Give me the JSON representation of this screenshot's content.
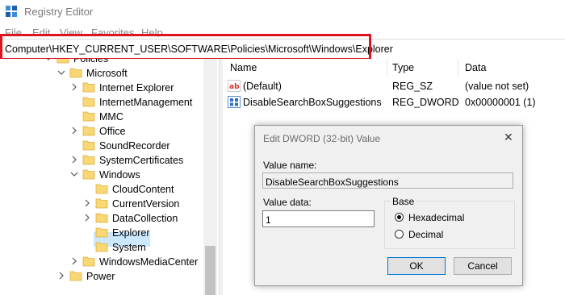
{
  "window": {
    "title": "Registry Editor"
  },
  "menu": [
    "File",
    "Edit",
    "View",
    "Favorites",
    "Help"
  ],
  "address": {
    "path": "Computer\\HKEY_CURRENT_USER\\SOFTWARE\\Policies\\Microsoft\\Windows\\Explorer"
  },
  "tree": {
    "items": [
      {
        "label": "Policies",
        "expanded": true,
        "selected": false
      },
      {
        "label": "Microsoft",
        "expanded": true,
        "selected": false
      },
      {
        "label": "Internet Explorer",
        "expanded": false,
        "selected": false
      },
      {
        "label": "InternetManagement",
        "expanded": false,
        "selected": false
      },
      {
        "label": "MMC",
        "expanded": false,
        "selected": false
      },
      {
        "label": "Office",
        "expanded": false,
        "selected": false
      },
      {
        "label": "SoundRecorder",
        "expanded": false,
        "selected": false
      },
      {
        "label": "SystemCertificates",
        "expanded": false,
        "selected": false
      },
      {
        "label": "Windows",
        "expanded": true,
        "selected": false
      },
      {
        "label": "CloudContent",
        "expanded": false,
        "selected": false
      },
      {
        "label": "CurrentVersion",
        "expanded": false,
        "selected": false
      },
      {
        "label": "DataCollection",
        "expanded": false,
        "selected": false
      },
      {
        "label": "Explorer",
        "expanded": false,
        "selected": true
      },
      {
        "label": "System",
        "expanded": false,
        "selected": false
      },
      {
        "label": "WindowsMediaCenter",
        "expanded": false,
        "selected": false
      },
      {
        "label": "Power",
        "expanded": false,
        "selected": false
      }
    ]
  },
  "values": {
    "headers": {
      "name": "Name",
      "type": "Type",
      "data": "Data"
    },
    "rows": [
      {
        "icon": "string-value-icon",
        "name": "(Default)",
        "type": "REG_SZ",
        "data": "(value not set)"
      },
      {
        "icon": "binary-value-icon",
        "name": "DisableSearchBoxSuggestions",
        "type": "REG_DWORD",
        "data": "0x00000001 (1)"
      }
    ]
  },
  "dialog": {
    "title": "Edit DWORD (32-bit) Value",
    "value_name_label": "Value name:",
    "value_name": "DisableSearchBoxSuggestions",
    "value_data_label": "Value data:",
    "value_data": "1",
    "base_label": "Base",
    "base_options": [
      {
        "label": "Hexadecimal",
        "selected": true
      },
      {
        "label": "Decimal",
        "selected": false
      }
    ],
    "ok_label": "OK",
    "cancel_label": "Cancel"
  },
  "colors": {
    "highlight": "#e0141e",
    "folder": "#f8d775",
    "selection": "#cce8ff"
  }
}
